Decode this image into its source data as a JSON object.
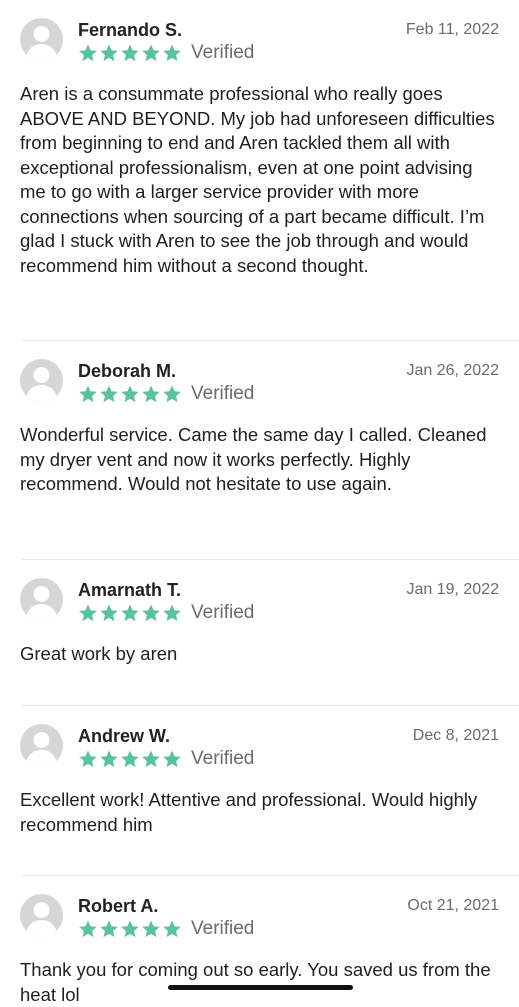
{
  "theme": {
    "star_color": "#5cc29a",
    "avatar_bg": "#d6d6d6"
  },
  "reviews": [
    {
      "name": "Fernando S.",
      "date": "Feb 11, 2022",
      "rating": 5,
      "verified_label": "Verified",
      "text": "Aren is a consummate professional who really goes ABOVE AND BEYOND. My job had unforeseen difficulties from beginning to end and Aren tackled them all with exceptional professionalism, even at one point advising me to go with a larger service provider with more connections when sourcing of a part became difficult. I’m glad I stuck with Aren to see the job through and would recommend him without a second thought."
    },
    {
      "name": "Deborah M.",
      "date": "Jan 26, 2022",
      "rating": 5,
      "verified_label": "Verified",
      "text": "Wonderful service. Came the same day I called. Cleaned my dryer vent and now it works perfectly. Highly recommend. Would not hesitate to use again."
    },
    {
      "name": "Amarnath T.",
      "date": "Jan 19, 2022",
      "rating": 5,
      "verified_label": "Verified",
      "text": "Great work by aren"
    },
    {
      "name": "Andrew W.",
      "date": "Dec 8, 2021",
      "rating": 5,
      "verified_label": "Verified",
      "text": "Excellent work! Attentive and professional. Would highly recommend him"
    },
    {
      "name": "Robert A.",
      "date": "Oct 21, 2021",
      "rating": 5,
      "verified_label": "Verified",
      "text": "Thank you for coming out so early. You saved us from the heat lol"
    }
  ]
}
